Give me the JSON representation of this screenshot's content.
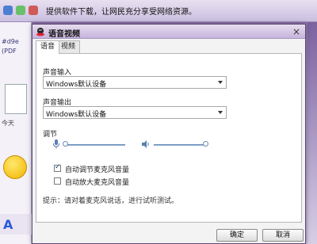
{
  "background": {
    "marquee": "提供软件下载，让网民充分享受网络资源。",
    "left_items": [
      "#d9e",
      "(PDF",
      "今天"
    ],
    "bottom_glyph": "A"
  },
  "dialog": {
    "title": "语音视频",
    "close_glyph": "×",
    "tabs": [
      {
        "label": "语音",
        "active": true
      },
      {
        "label": "视频",
        "active": false
      }
    ],
    "input_label": "声音输入",
    "input_value": "Windows默认设备",
    "output_label": "声音输出",
    "output_value": "Windows默认设备",
    "adjust_label": "调节",
    "mic_level": 0,
    "speaker_level": 1,
    "checkbox_auto_adjust": {
      "label": "自动调节麦克风音量",
      "checked": true
    },
    "checkbox_auto_amplify": {
      "label": "自动放大麦克风音量",
      "checked": false
    },
    "hint": "提示：请对着麦克风说话，进行试听测试。",
    "ok_label": "确定",
    "cancel_label": "取消"
  },
  "colors": {
    "accent": "#7b62a3",
    "titlebar": "#d6c8e6",
    "slider": "#8fb0d6"
  }
}
